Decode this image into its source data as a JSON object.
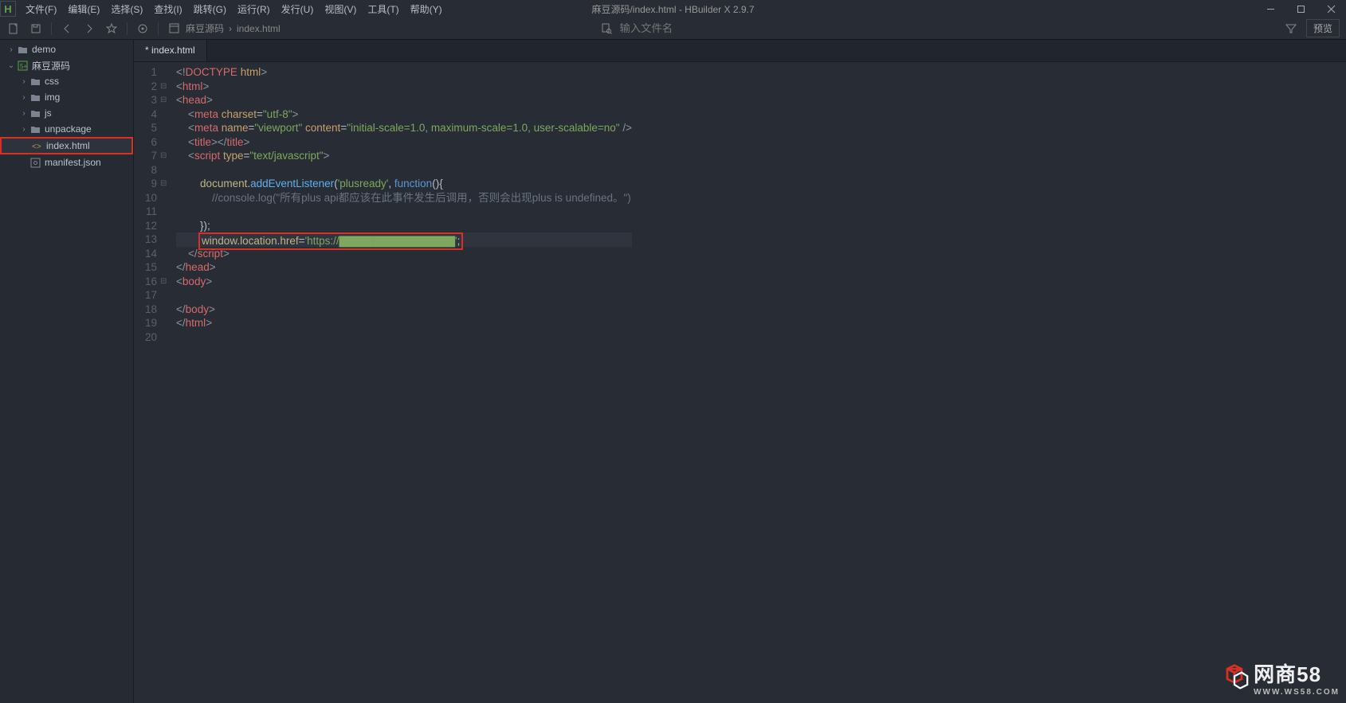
{
  "title": "麻豆源码/index.html - HBuilder X 2.9.7",
  "menu": [
    "文件(F)",
    "编辑(E)",
    "选择(S)",
    "查找(I)",
    "跳转(G)",
    "运行(R)",
    "发行(U)",
    "视图(V)",
    "工具(T)",
    "帮助(Y)"
  ],
  "breadcrumb": [
    "麻豆源码",
    "index.html"
  ],
  "search_placeholder": "输入文件名",
  "preview_label": "预览",
  "tab_label": "* index.html",
  "tree": [
    {
      "depth": 0,
      "chev": "›",
      "icon": "folder",
      "label": "demo"
    },
    {
      "depth": 0,
      "chev": "⌄",
      "icon": "app",
      "label": "麻豆源码"
    },
    {
      "depth": 1,
      "chev": "›",
      "icon": "folder",
      "label": "css"
    },
    {
      "depth": 1,
      "chev": "›",
      "icon": "folder",
      "label": "img"
    },
    {
      "depth": 1,
      "chev": "›",
      "icon": "folder",
      "label": "js"
    },
    {
      "depth": 1,
      "chev": "›",
      "icon": "folder",
      "label": "unpackage"
    },
    {
      "depth": 1,
      "chev": "",
      "icon": "code",
      "label": "index.html",
      "selected": true
    },
    {
      "depth": 1,
      "chev": "",
      "icon": "json",
      "label": "manifest.json"
    }
  ],
  "lines": [
    {
      "n": 1,
      "fold": "",
      "html": "<span class='tag-bracket'>&lt;!</span><span class='tag-name'>DOCTYPE</span> <span class='attr-name'>html</span><span class='tag-bracket'>&gt;</span>"
    },
    {
      "n": 2,
      "fold": "⊟",
      "html": "<span class='tag-bracket'>&lt;</span><span class='tag-name'>html</span><span class='tag-bracket'>&gt;</span>"
    },
    {
      "n": 3,
      "fold": "⊟",
      "html": "<span class='tag-bracket'>&lt;</span><span class='tag-name'>head</span><span class='tag-bracket'>&gt;</span>"
    },
    {
      "n": 4,
      "fold": "",
      "html": "    <span class='tag-bracket'>&lt;</span><span class='tag-name'>meta</span> <span class='attr-name'>charset</span><span class='punc'>=</span><span class='attr-val'>\"utf-8\"</span><span class='tag-bracket'>&gt;</span>"
    },
    {
      "n": 5,
      "fold": "",
      "html": "    <span class='tag-bracket'>&lt;</span><span class='tag-name'>meta</span> <span class='attr-name'>name</span><span class='punc'>=</span><span class='attr-val'>\"viewport\"</span> <span class='attr-name'>content</span><span class='punc'>=</span><span class='attr-val'>\"initial-scale=1.0, maximum-scale=1.0, user-scalable=no\"</span> <span class='tag-bracket'>/&gt;</span>"
    },
    {
      "n": 6,
      "fold": "",
      "html": "    <span class='tag-bracket'>&lt;</span><span class='tag-name'>title</span><span class='tag-bracket'>&gt;&lt;/</span><span class='tag-name'>title</span><span class='tag-bracket'>&gt;</span>"
    },
    {
      "n": 7,
      "fold": "⊟",
      "html": "    <span class='tag-bracket'>&lt;</span><span class='tag-name'>script</span> <span class='attr-name'>type</span><span class='punc'>=</span><span class='attr-val'>\"text/javascript\"</span><span class='tag-bracket'>&gt;</span>"
    },
    {
      "n": 8,
      "fold": "",
      "html": ""
    },
    {
      "n": 9,
      "fold": "⊟",
      "html": "        <span class='ident'>document</span><span class='punc'>.</span><span class='fn'>addEventListener</span><span class='punc'>(</span><span class='str'>'plusready'</span><span class='punc'>, </span><span class='kw'>function</span><span class='punc'>(){</span>"
    },
    {
      "n": 10,
      "fold": "",
      "html": "            <span class='comment'>//console.log(\"所有plus api都应该在此事件发生后调用，否则会出现plus is undefined。\")</span>"
    },
    {
      "n": 11,
      "fold": "",
      "html": ""
    },
    {
      "n": 12,
      "fold": "",
      "html": "        <span class='punc'>});</span>"
    },
    {
      "n": 13,
      "fold": "",
      "current": true,
      "boxed": true,
      "html": "        <span class='ident'>window</span><span class='punc'>.</span><span class='ident'>location</span><span class='punc'>.</span><span class='ident'>href</span><span class='punc'>=</span><span class='str'>'https://▇▇▇▇▇▇▇▇▇▇▇▇▇▇'</span><span class='punc'>;</span>"
    },
    {
      "n": 14,
      "fold": "",
      "html": "    <span class='tag-bracket'>&lt;/</span><span class='tag-name'>script</span><span class='tag-bracket'>&gt;</span>"
    },
    {
      "n": 15,
      "fold": "",
      "html": "<span class='tag-bracket'>&lt;/</span><span class='tag-name'>head</span><span class='tag-bracket'>&gt;</span>"
    },
    {
      "n": 16,
      "fold": "⊟",
      "html": "<span class='tag-bracket'>&lt;</span><span class='tag-name'>body</span><span class='tag-bracket'>&gt;</span>"
    },
    {
      "n": 17,
      "fold": "",
      "html": ""
    },
    {
      "n": 18,
      "fold": "",
      "html": "<span class='tag-bracket'>&lt;/</span><span class='tag-name'>body</span><span class='tag-bracket'>&gt;</span>"
    },
    {
      "n": 19,
      "fold": "",
      "html": "<span class='tag-bracket'>&lt;/</span><span class='tag-name'>html</span><span class='tag-bracket'>&gt;</span>"
    },
    {
      "n": 20,
      "fold": "",
      "html": ""
    }
  ],
  "watermark": {
    "text": "网商58",
    "sub": "WWW.WS58.COM"
  }
}
